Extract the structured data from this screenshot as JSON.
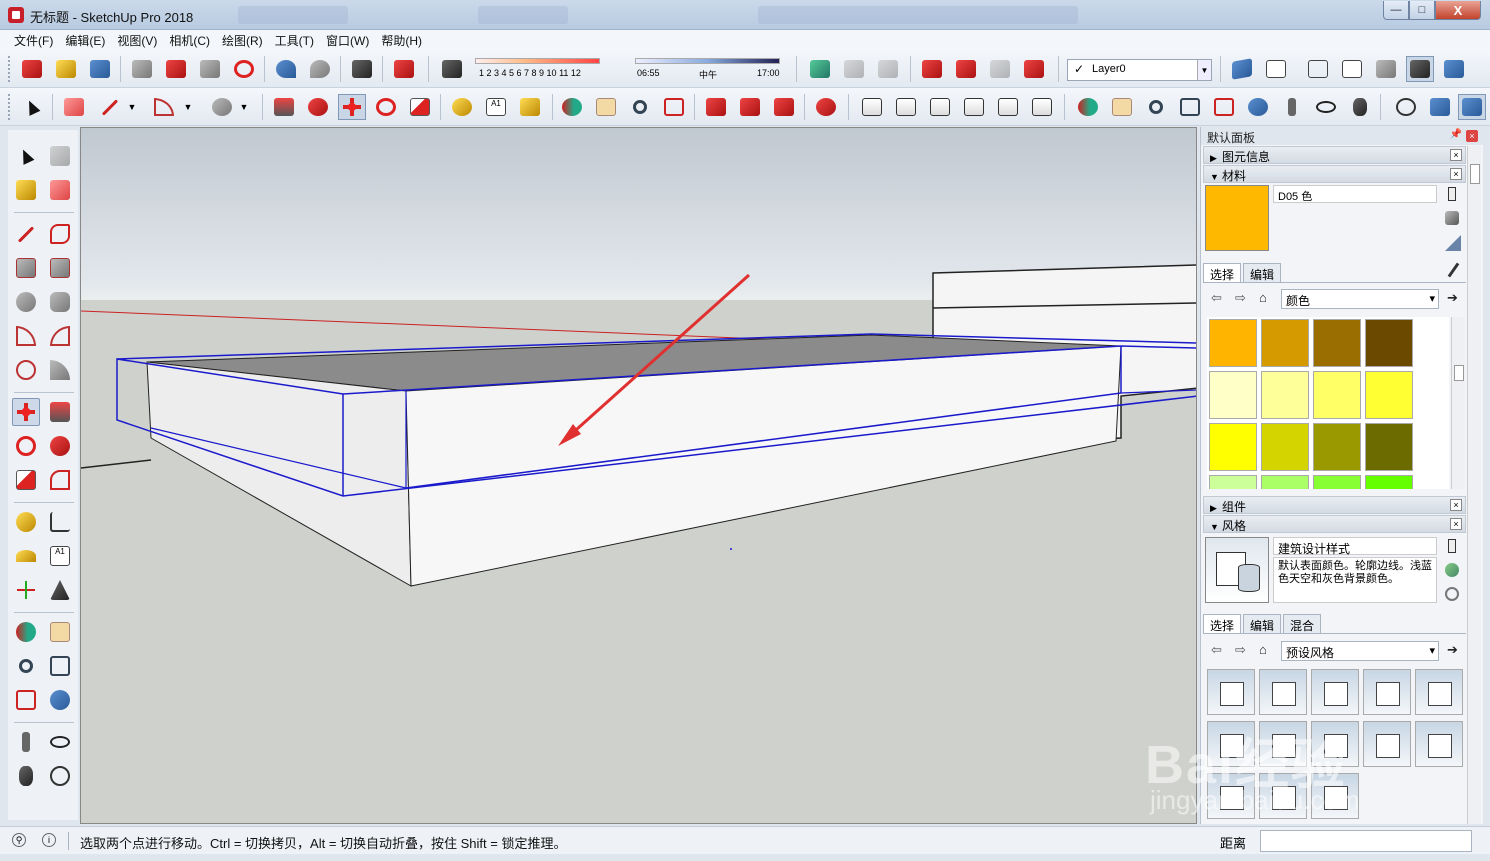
{
  "window": {
    "title": "无标题 - SketchUp Pro 2018",
    "buttons": {
      "minimize": "—",
      "maximize": "□",
      "close": "X"
    }
  },
  "menu": [
    "文件(F)",
    "编辑(E)",
    "视图(V)",
    "相机(C)",
    "绘图(R)",
    "工具(T)",
    "窗口(W)",
    "帮助(H)"
  ],
  "shadow": {
    "months": "1 2 3 4 5 6 7 8 9 10 11 12",
    "time_start": "06:55",
    "time_mid": "中午",
    "time_end": "17:00"
  },
  "layer": {
    "name": "Layer0",
    "check": "✓"
  },
  "panel": {
    "title": "默认面板",
    "entity_info": "图元信息",
    "materials": {
      "header": "材料",
      "current_name": "D05 色",
      "current_color": "#ffb800",
      "tabs": [
        "选择",
        "编辑"
      ],
      "library": "颜色",
      "swatches": [
        "#ffb400",
        "#d49a00",
        "#9a6e00",
        "#6b4a00",
        "#ffffc8",
        "#ffff9a",
        "#ffff66",
        "#ffff33",
        "#ffff00",
        "#d4d400",
        "#9a9a00",
        "#6b6b00",
        "#ccff99",
        "#aaff66",
        "#88ff33",
        "#66ff00"
      ]
    },
    "components": "组件",
    "styles": {
      "header": "风格",
      "current_name": "建筑设计样式",
      "description": "默认表面颜色。轮廓边线。浅蓝色天空和灰色背景颜色。",
      "tabs": [
        "选择",
        "编辑",
        "混合"
      ],
      "library": "预设风格"
    }
  },
  "status": {
    "message": "选取两个点进行移动。Ctrl = 切换拷贝，Alt = 切换自动折叠，按住 Shift = 锁定推理。",
    "measure_label": "距离",
    "measure_value": ""
  },
  "watermark": {
    "main": "Bai经验",
    "sub": "jingyan.baidu.com"
  },
  "colors": {
    "selection": "#1a1acc",
    "arrow": "#e03030",
    "axis_red": "#cc2222",
    "ground": "#cfd1cc",
    "sky_top": "#c0c8d0"
  }
}
